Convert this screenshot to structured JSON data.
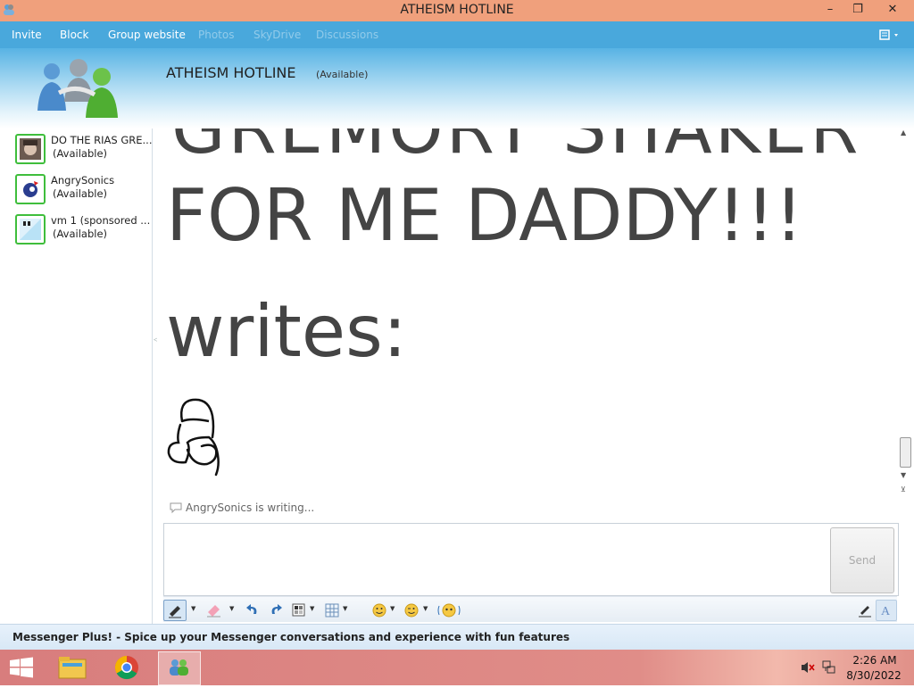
{
  "window": {
    "title": "ATHEISM HOTLINE",
    "controls": {
      "minimize": "–",
      "maximize": "❐",
      "close": "✕"
    }
  },
  "menu": {
    "items": [
      {
        "label": "Invite",
        "enabled": true
      },
      {
        "label": "Block",
        "enabled": true
      },
      {
        "label": "Group website",
        "enabled": true
      },
      {
        "label": "Photos",
        "enabled": false
      },
      {
        "label": "SkyDrive",
        "enabled": false
      },
      {
        "label": "Discussions",
        "enabled": false
      }
    ]
  },
  "conversation": {
    "name": "ATHEISM HOTLINE",
    "status": "(Available)"
  },
  "contacts": [
    {
      "name": "DO THE RIAS GRE...",
      "status": "(Available)"
    },
    {
      "name": "AngrySonics",
      "status": "(Available)"
    },
    {
      "name": "vm 1 (sponsored ...",
      "status": "(Available)"
    }
  ],
  "messages": {
    "partial_line": "GREMORY SHAKER",
    "line1": "FOR ME DADDY!!!",
    "line2": "writes:"
  },
  "typing_indicator": "AngrySonics is writing...",
  "compose": {
    "send_label": "Send",
    "value": ""
  },
  "statusbar": {
    "ad_text": "Messenger Plus! - Spice up your Messenger conversations and experience with fun features"
  },
  "taskbar": {
    "time": "2:26 AM",
    "date": "8/30/2022"
  },
  "colors": {
    "titlebar": "#f0a07c",
    "menubar": "#49a8dc",
    "contact_border": "#3fbe3c",
    "taskbar": "#d87d7d"
  }
}
